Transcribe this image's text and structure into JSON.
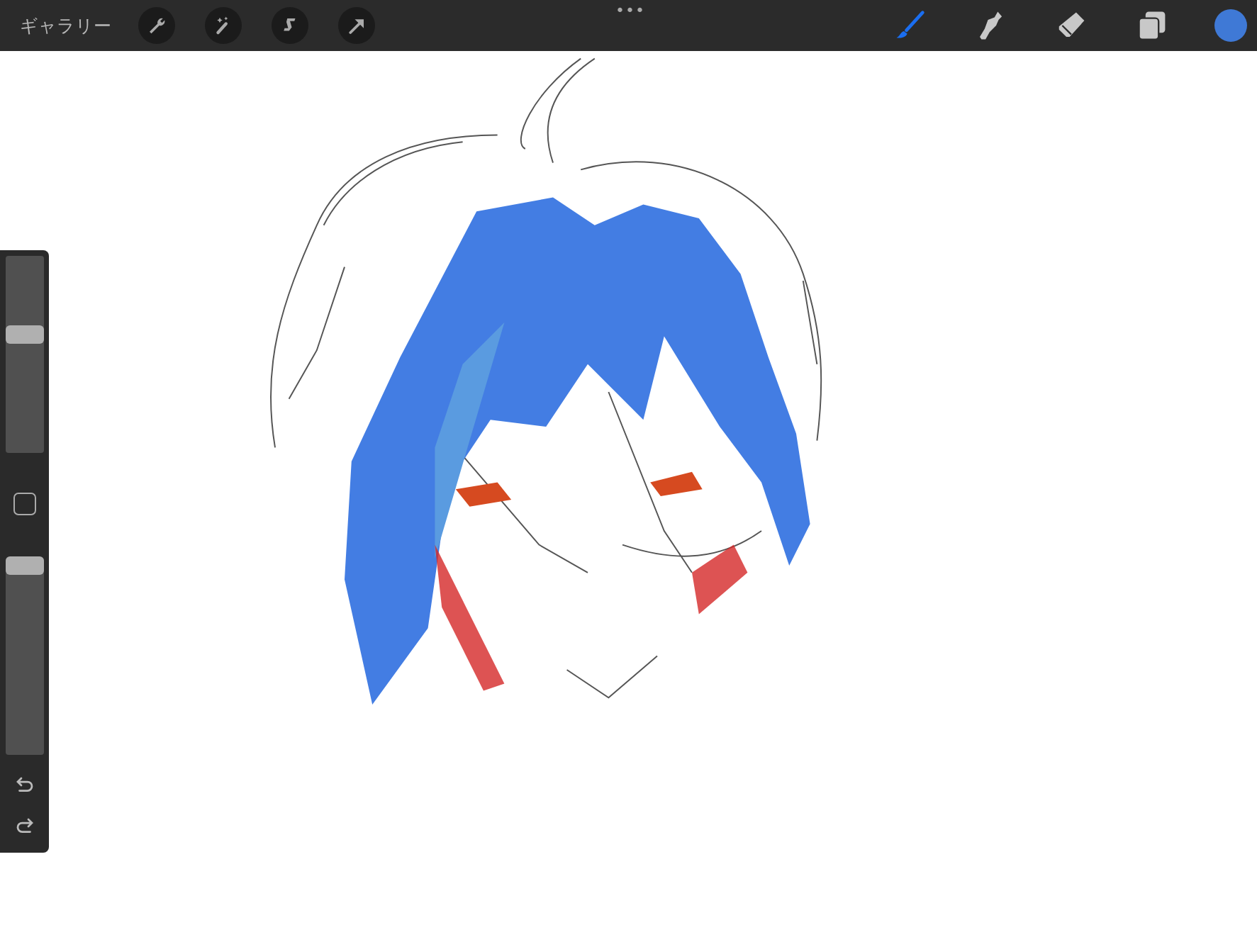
{
  "toolbar": {
    "gallery": "ギャラリー",
    "actions": [
      {
        "kind": "wrench"
      },
      {
        "kind": "wand"
      },
      {
        "kind": "selection"
      },
      {
        "kind": "transform"
      }
    ],
    "more": "•••",
    "tools": [
      {
        "kind": "brush",
        "selected": true
      },
      {
        "kind": "smudge",
        "selected": false
      },
      {
        "kind": "eraser",
        "selected": false
      },
      {
        "kind": "layers",
        "selected": false
      }
    ],
    "color": "#3f79d6"
  },
  "sidebar": {
    "size": {
      "level": 0.6
    },
    "opacity": {
      "level": 0.96
    }
  }
}
